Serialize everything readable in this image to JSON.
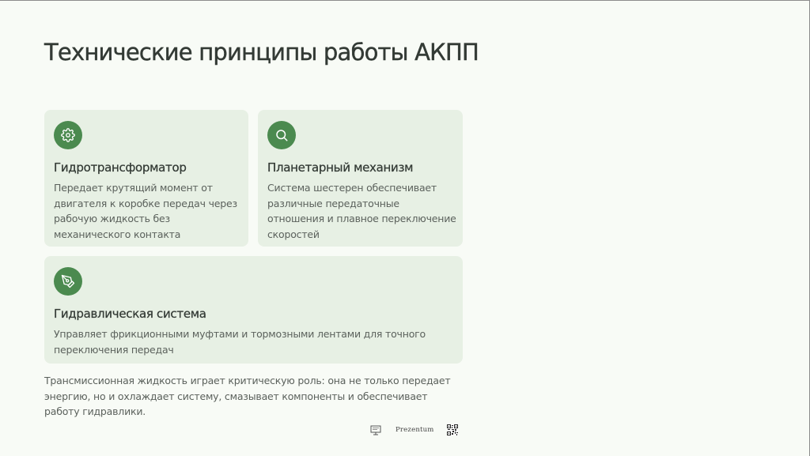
{
  "title": "Технические принципы работы АКПП",
  "cards": [
    {
      "icon": "gear-icon",
      "title": "Гидротрансформатор",
      "text": "Передает крутящий момент от двигателя к коробке передач через рабочую жидкость без механического контакта"
    },
    {
      "icon": "search-icon",
      "title": "Планетарный механизм",
      "text": "Система шестерен обеспечивает различные передаточные отношения и плавное переключение скоростей"
    },
    {
      "icon": "pen-tool-icon",
      "title": "Гидравлическая система",
      "text": "Управляет фрикционными муфтами и тормозными лентами для точного переключения передач"
    }
  ],
  "footnote": "Трансмиссионная жидкость играет критическую роль: она не только передает энергию, но и охлаждает систему, смазывает компоненты и обеспечивает работу гидравлики.",
  "footer": {
    "brand": "Prezentum"
  },
  "colors": {
    "background": "#f8fbf6",
    "card": "#e7f0e4",
    "accent": "#4b8a4f"
  }
}
